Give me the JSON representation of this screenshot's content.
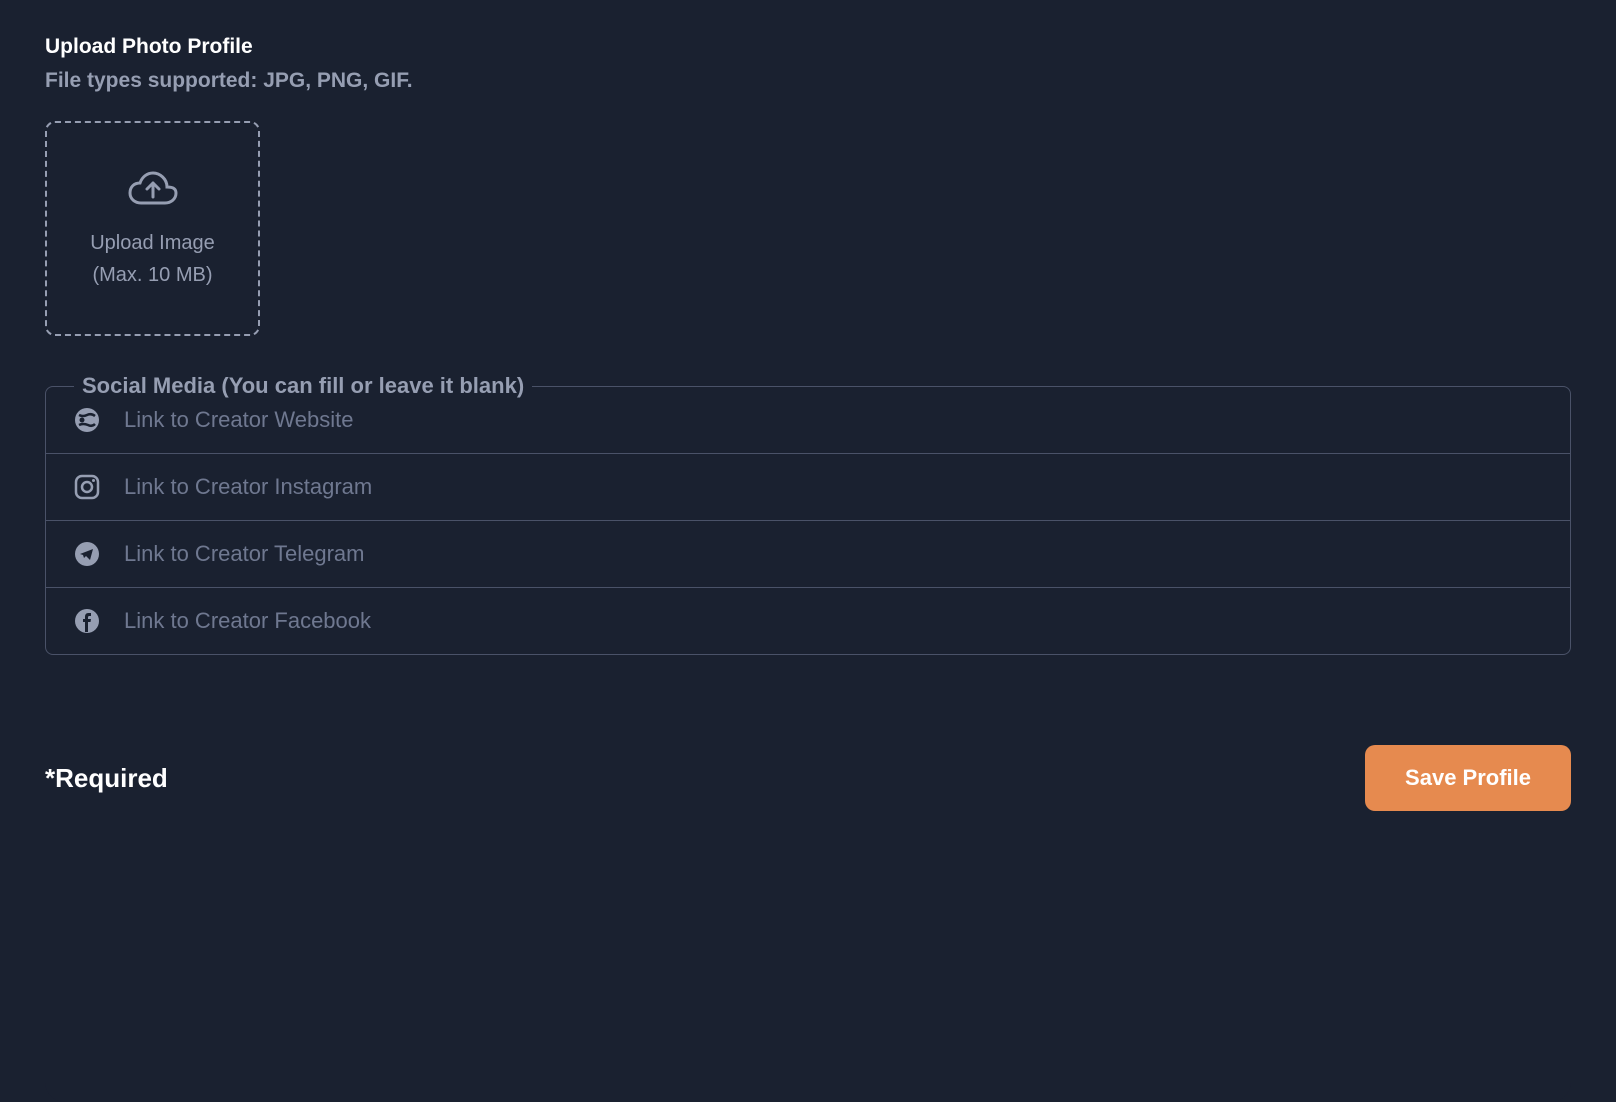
{
  "upload": {
    "heading": "Upload Photo Profile",
    "subheading": "File types supported: JPG, PNG, GIF.",
    "box_text_line1": "Upload Image",
    "box_text_line2": "(Max. 10 MB)"
  },
  "social": {
    "legend": "Social Media (You can fill or leave it blank)",
    "website_placeholder": "Link to Creator Website",
    "instagram_placeholder": "Link to Creator Instagram",
    "telegram_placeholder": "Link to Creator Telegram",
    "facebook_placeholder": "Link to Creator Facebook"
  },
  "footer": {
    "required": "*Required",
    "save_label": "Save Profile"
  }
}
